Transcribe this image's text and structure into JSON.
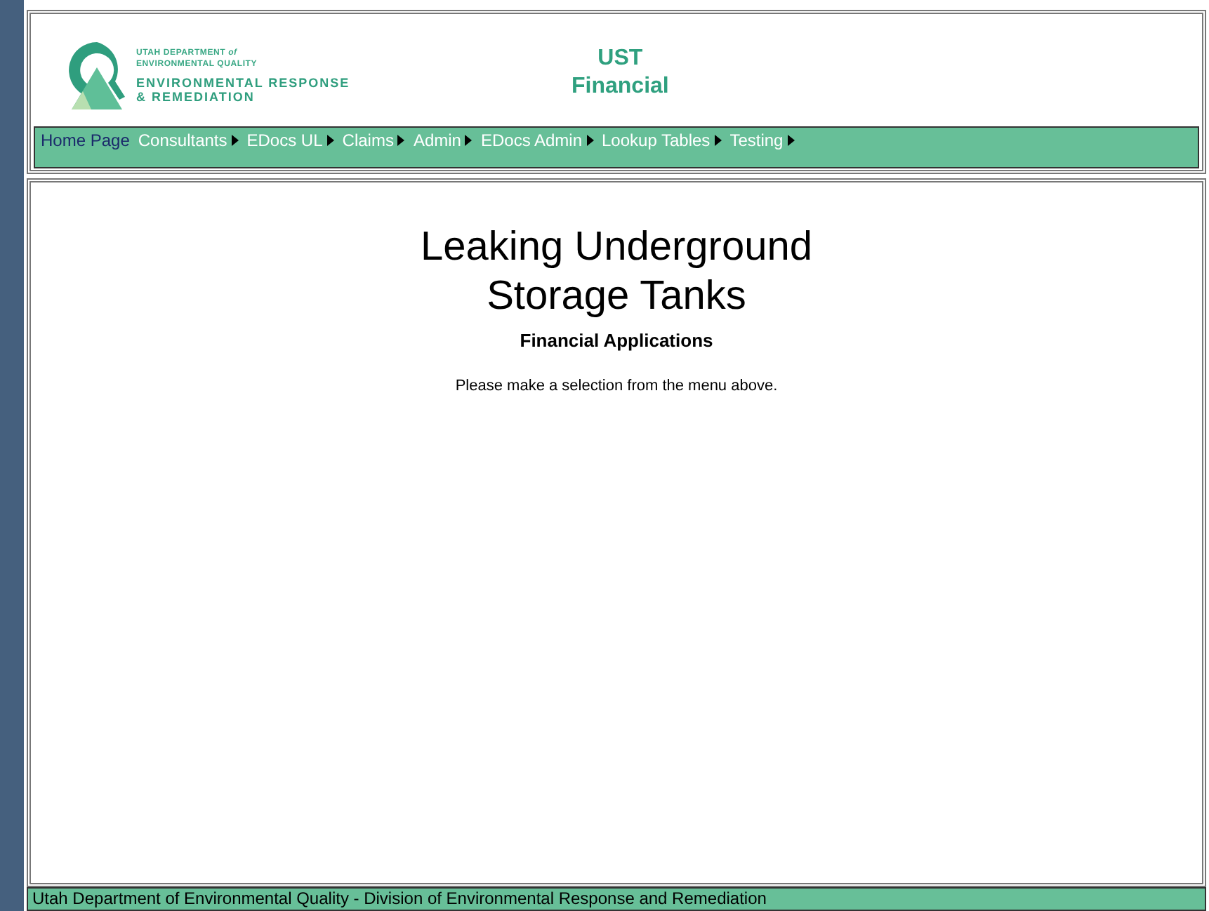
{
  "logo": {
    "lines": [
      "UTAH DEPARTMENT *of*",
      "ENVIRONMENTAL QUALITY"
    ],
    "name_lines": [
      "ENVIRONMENTAL RESPONSE",
      "& REMEDIATION"
    ]
  },
  "header_title": [
    "UST",
    "Financial"
  ],
  "menu": [
    {
      "label": "Home Page",
      "selected": true,
      "submenu": false
    },
    {
      "label": "Consultants",
      "selected": false,
      "submenu": true
    },
    {
      "label": "EDocs UL",
      "selected": false,
      "submenu": true
    },
    {
      "label": "Claims",
      "selected": false,
      "submenu": true
    },
    {
      "label": "Admin",
      "selected": false,
      "submenu": true
    },
    {
      "label": "EDocs Admin",
      "selected": false,
      "submenu": true
    },
    {
      "label": "Lookup Tables",
      "selected": false,
      "submenu": true
    },
    {
      "label": "Testing",
      "selected": false,
      "submenu": true
    }
  ],
  "content": {
    "title": [
      "Leaking Underground",
      "Storage Tanks"
    ],
    "subtitle": "Financial Applications",
    "message": "Please make a selection from the menu above."
  },
  "footer": "Utah Department of Environmental Quality - Division of Environmental Response and Remediation"
}
